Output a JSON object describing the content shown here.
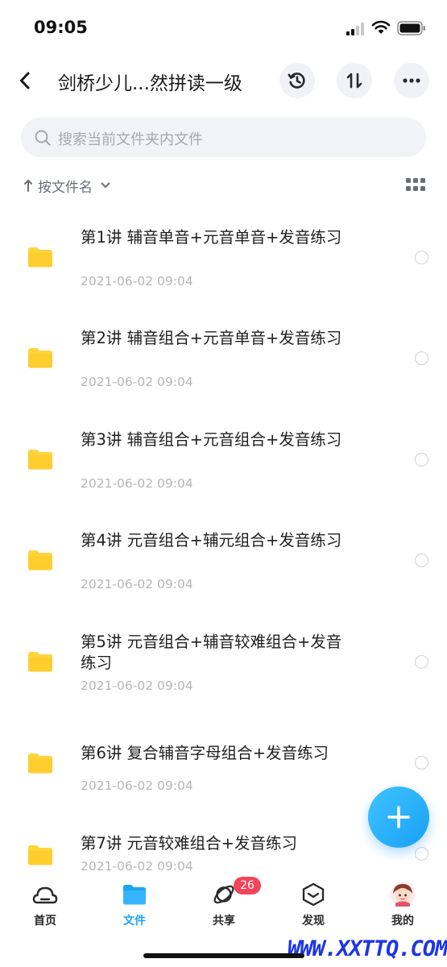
{
  "status_bar": {
    "time": "09:05",
    "icons": [
      "signal-icon",
      "wifi-icon",
      "battery-icon"
    ]
  },
  "nav": {
    "title": "剑桥少儿...然拼读一级",
    "back_icon": "chevron-left-icon",
    "actions": [
      "history-icon",
      "sort-transfer-icon",
      "more-icon"
    ]
  },
  "search": {
    "placeholder": "搜索当前文件夹内文件"
  },
  "sort": {
    "label": "按文件名",
    "arrow_icon": "arrow-up-icon",
    "dropdown_icon": "chevron-down-icon",
    "view_icon": "grid-view-icon"
  },
  "files": [
    {
      "name": "第1讲 辅音单音+元音单音+发音练习",
      "date": "2021-06-02 09:04"
    },
    {
      "name": "第2讲 辅音组合+元音单音+发音练习",
      "date": "2021-06-02 09:04"
    },
    {
      "name": "第3讲 辅音组合+元音组合+发音练习",
      "date": "2021-06-02 09:04"
    },
    {
      "name": "第4讲 元音组合+辅元组合+发音练习",
      "date": "2021-06-02 09:04"
    },
    {
      "name": "第5讲 元音组合+辅音较难组合+发音练习",
      "date": "2021-06-02 09:04"
    },
    {
      "name": "第6讲 复合辅音字母组合+发音练习",
      "date": "2021-06-02 09:04"
    },
    {
      "name": "第7讲 元音较难组合+发音练习",
      "date": "2021-06-02 09:04"
    }
  ],
  "tabs": [
    {
      "label": "首页",
      "icon": "cloud-icon"
    },
    {
      "label": "文件",
      "icon": "folder-icon"
    },
    {
      "label": "共享",
      "icon": "share-orbit-icon",
      "badge": "26"
    },
    {
      "label": "发现",
      "icon": "discover-icon"
    },
    {
      "label": "我的",
      "icon": "avatar-icon"
    }
  ],
  "colors": {
    "accent": "#1aa5f4",
    "folder": "#ffd43b",
    "badge": "#f0455a",
    "watermark": "#1d35e6"
  },
  "watermark": "WWW.XXTTQ.COM"
}
